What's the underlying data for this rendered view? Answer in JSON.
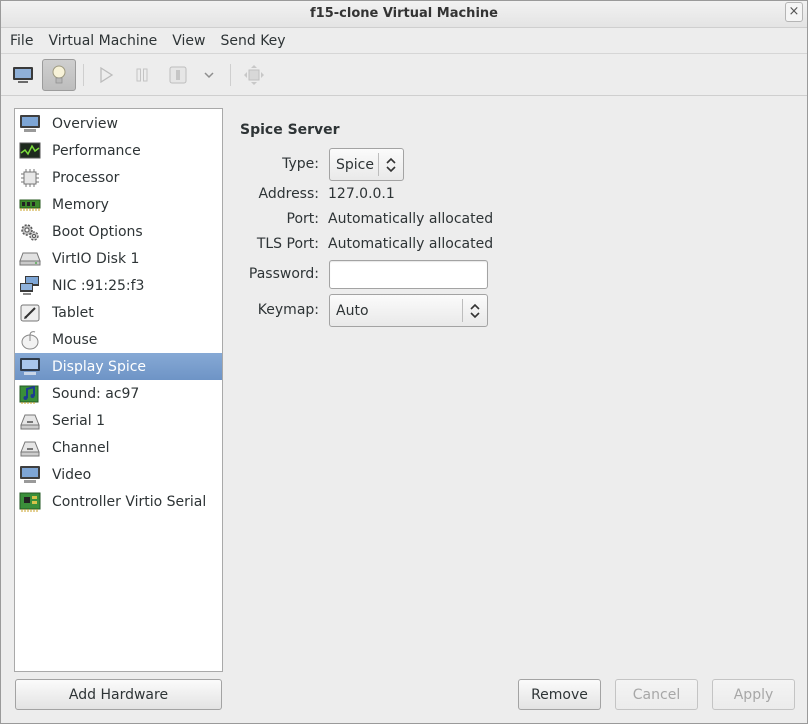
{
  "window": {
    "title": "f15-clone Virtual Machine",
    "close_glyph": "×"
  },
  "menubar": {
    "items": [
      "File",
      "Virtual Machine",
      "View",
      "Send Key"
    ]
  },
  "toolbar": {
    "buttons": [
      {
        "icon": "monitor-icon",
        "state": "normal"
      },
      {
        "icon": "lightbulb-icon",
        "state": "active"
      },
      {
        "icon": "play-icon",
        "state": "disabled"
      },
      {
        "icon": "pause-icon",
        "state": "disabled"
      },
      {
        "icon": "power-icon",
        "state": "disabled"
      },
      {
        "icon": "chevron-down-icon",
        "state": "disabled"
      },
      {
        "icon": "fullscreen-icon",
        "state": "disabled"
      }
    ]
  },
  "sidebar": {
    "selected_color": "#7a9ecf",
    "items": [
      {
        "label": "Overview",
        "icon": "monitor-icon"
      },
      {
        "label": "Performance",
        "icon": "performance-graph-icon"
      },
      {
        "label": "Processor",
        "icon": "cpu-chip-icon"
      },
      {
        "label": "Memory",
        "icon": "memory-ram-icon"
      },
      {
        "label": "Boot Options",
        "icon": "gears-icon"
      },
      {
        "label": "VirtIO Disk 1",
        "icon": "hard-disk-icon"
      },
      {
        "label": "NIC :91:25:f3",
        "icon": "network-icon"
      },
      {
        "label": "Tablet",
        "icon": "tablet-icon"
      },
      {
        "label": "Mouse",
        "icon": "mouse-icon"
      },
      {
        "label": "Display Spice",
        "icon": "display-icon",
        "selected": true
      },
      {
        "label": "Sound: ac97",
        "icon": "sound-card-icon"
      },
      {
        "label": "Serial 1",
        "icon": "serial-port-icon"
      },
      {
        "label": "Channel",
        "icon": "channel-icon"
      },
      {
        "label": "Video",
        "icon": "video-icon"
      },
      {
        "label": "Controller Virtio Serial",
        "icon": "controller-icon"
      }
    ]
  },
  "details": {
    "section_title": "Spice Server",
    "type_label": "Type:",
    "type_value": "Spice",
    "address_label": "Address:",
    "address_value": "127.0.0.1",
    "port_label": "Port:",
    "port_value": "Automatically allocated",
    "tls_port_label": "TLS Port:",
    "tls_port_value": "Automatically allocated",
    "password_label": "Password:",
    "password_value": "",
    "keymap_label": "Keymap:",
    "keymap_value": "Auto"
  },
  "buttons": {
    "add_hardware": "Add Hardware",
    "remove": "Remove",
    "cancel": "Cancel",
    "apply": "Apply"
  }
}
